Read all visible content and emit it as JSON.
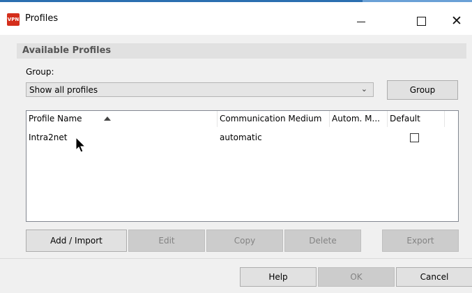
{
  "window": {
    "icon_text": "VPN",
    "title": "Profiles",
    "minimize_icon": "minimize-icon",
    "maximize_icon": "maximize-icon",
    "close_icon": "close-icon",
    "close_glyph": "✕"
  },
  "section": {
    "title": "Available Profiles"
  },
  "group": {
    "label": "Group:",
    "select_value": "Show all profiles",
    "button_label": "Group"
  },
  "list": {
    "columns": [
      "Profile Name",
      "Communication Medium",
      "Autom. M...",
      "Default"
    ],
    "sort_icon": "sort-ascending-icon",
    "rows": [
      {
        "name": "Intra2net",
        "medium": "automatic",
        "autom": "",
        "default": false
      }
    ]
  },
  "actions": {
    "add_import": "Add / Import",
    "edit": "Edit",
    "copy": "Copy",
    "delete": "Delete",
    "export": "Export"
  },
  "footer": {
    "help": "Help",
    "ok": "OK",
    "cancel": "Cancel"
  },
  "colors": {
    "titlebar_accent": "#2b6fb0",
    "app_icon": "#d42e1b",
    "panel_bg": "#f0f0f0",
    "disabled_button": "#cccccc"
  }
}
